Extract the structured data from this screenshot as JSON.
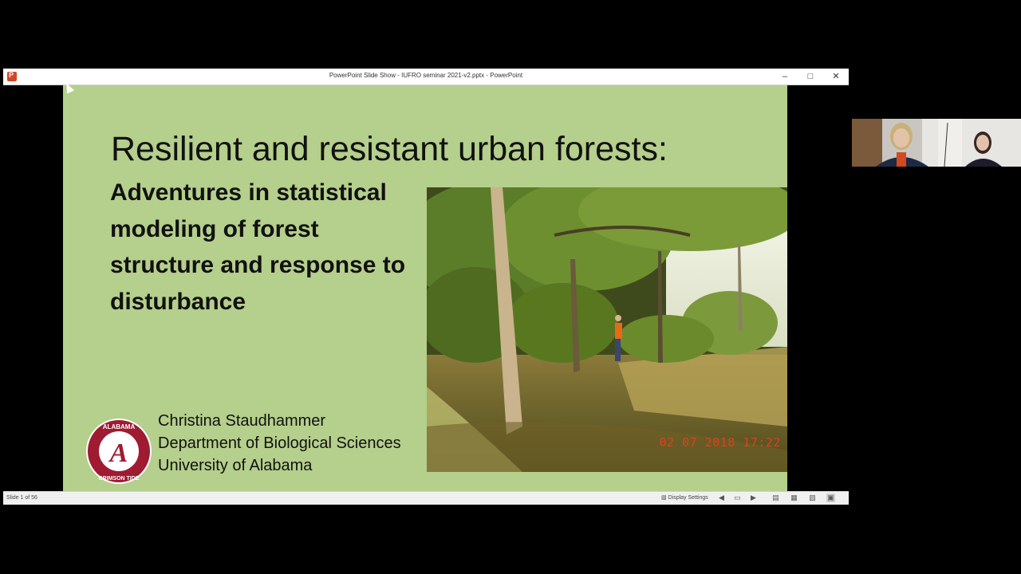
{
  "window": {
    "title": "PowerPoint Slide Show  -  IUFRO seminar 2021-v2.pptx - PowerPoint",
    "minimize_icon": "minimize-icon",
    "maximize_icon": "maximize-icon",
    "close_icon": "close-icon"
  },
  "slide": {
    "heading": "Resilient and resistant urban forests:",
    "subtitle": "Adventures in statistical modeling of forest structure and response to disturbance",
    "photo_timestamp": "02 07 2018 17:22",
    "author_name": "Christina Staudhammer",
    "department": "Department of Biological Sciences",
    "university": "University of Alabama",
    "logo_text_top": "ALABAMA",
    "logo_text_bottom": "CRIMSON TIDE",
    "logo_letter": "A",
    "background_color": "#b5cf8c"
  },
  "statusbar": {
    "slide_counter": "Slide 1 of 56",
    "display_settings": "Display Settings"
  },
  "participants": [
    {
      "name": "participant-1"
    },
    {
      "name": "participant-2"
    }
  ]
}
